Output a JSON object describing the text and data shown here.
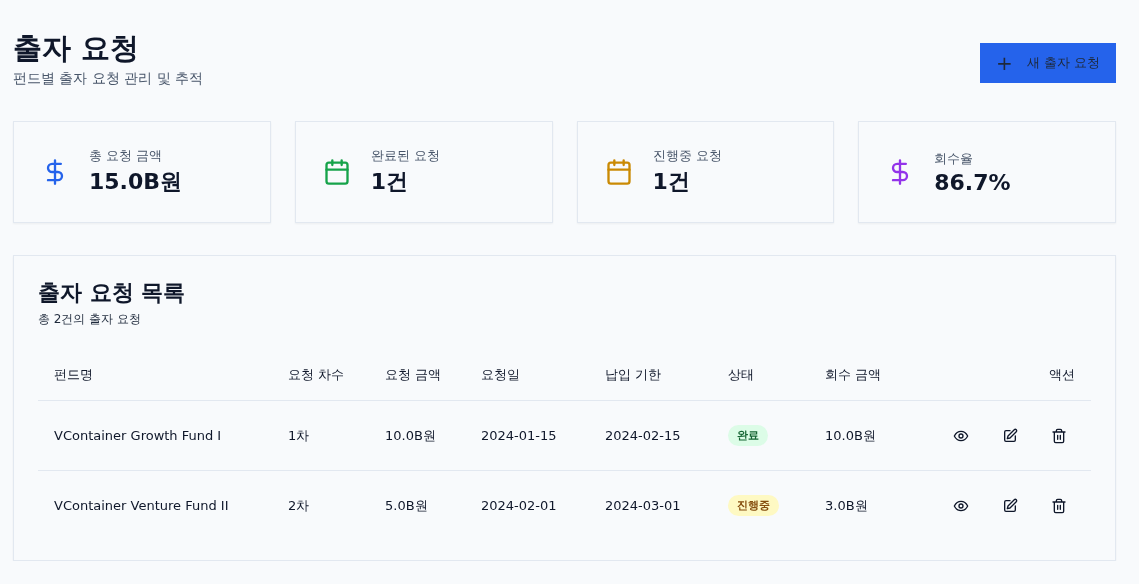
{
  "header": {
    "title": "출자 요청",
    "subtitle": "펀드별 출자 요청 관리 및 추적",
    "new_button": {
      "icon": "+",
      "label": "새 출자 요청"
    }
  },
  "stats": [
    {
      "label": "총 요청 금액",
      "value": "15.0B원",
      "kind": "money",
      "color": "#2563eb"
    },
    {
      "label": "완료된 요청",
      "value": "1건",
      "kind": "count",
      "color": "#16a34a"
    },
    {
      "label": "진행중 요청",
      "value": "1건",
      "kind": "count",
      "color": "#ca8a04"
    },
    {
      "label": "회수율",
      "value": "86.7%",
      "kind": "money",
      "color": "#9333ea"
    }
  ],
  "list": {
    "title": "출자 요청 목록",
    "subtitle": "총 2건의 출자 요청",
    "columns": [
      "펀드명",
      "요청 차수",
      "요청 금액",
      "요청일",
      "납입 기한",
      "상태",
      "회수 금액",
      "액션"
    ],
    "rows": [
      {
        "fund": "VContainer Growth Fund I",
        "round": "1차",
        "amount": "10.0B원",
        "requested": "2024-01-15",
        "due": "2024-02-15",
        "status": {
          "label": "완료",
          "kind": "done"
        },
        "recovered": "10.0B원"
      },
      {
        "fund": "VContainer Venture Fund II",
        "round": "2차",
        "amount": "5.0B원",
        "requested": "2024-02-01",
        "due": "2024-03-01",
        "status": {
          "label": "진행중",
          "kind": "progress"
        },
        "recovered": "3.0B원"
      }
    ]
  }
}
